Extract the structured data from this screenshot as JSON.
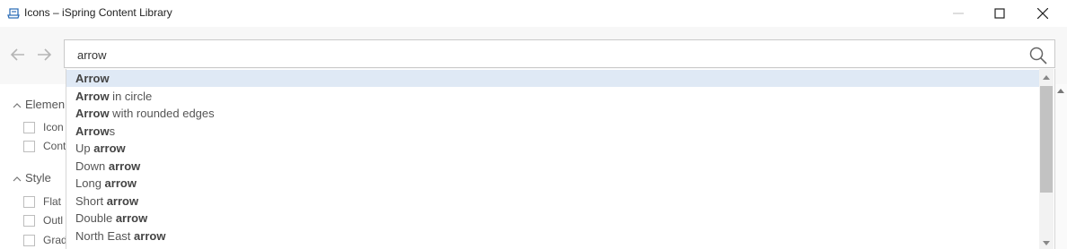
{
  "window": {
    "title": "Icons – iSpring Content Library",
    "controls": [
      "minimize",
      "maximize",
      "close"
    ]
  },
  "toolbar": {
    "back_icon": "arrow-left-icon",
    "forward_icon": "arrow-right-icon",
    "search": {
      "value": "arrow",
      "placeholder": "",
      "icon": "search-icon"
    }
  },
  "filters": {
    "groups": [
      {
        "label": "Elemen",
        "items": [
          "Icon",
          "Cont"
        ]
      },
      {
        "label": "Style",
        "items": [
          "Flat",
          "Outl",
          "Grad"
        ]
      }
    ]
  },
  "suggestions": [
    {
      "pre": "",
      "bold": "Arrow",
      "post": ""
    },
    {
      "pre": "",
      "bold": "Arrow",
      "post": " in circle"
    },
    {
      "pre": "",
      "bold": "Arrow",
      "post": " with rounded edges"
    },
    {
      "pre": "",
      "bold": "Arrow",
      "post": "s"
    },
    {
      "pre": "Up ",
      "bold": "arrow",
      "post": ""
    },
    {
      "pre": "Down ",
      "bold": "arrow",
      "post": ""
    },
    {
      "pre": "Long ",
      "bold": "arrow",
      "post": ""
    },
    {
      "pre": "Short ",
      "bold": "arrow",
      "post": ""
    },
    {
      "pre": "Double ",
      "bold": "arrow",
      "post": ""
    },
    {
      "pre": "North East ",
      "bold": "arrow",
      "post": ""
    }
  ],
  "colors": {
    "selected_row": "#dfe9f5",
    "toolbar_bg": "#f7f7f7"
  }
}
